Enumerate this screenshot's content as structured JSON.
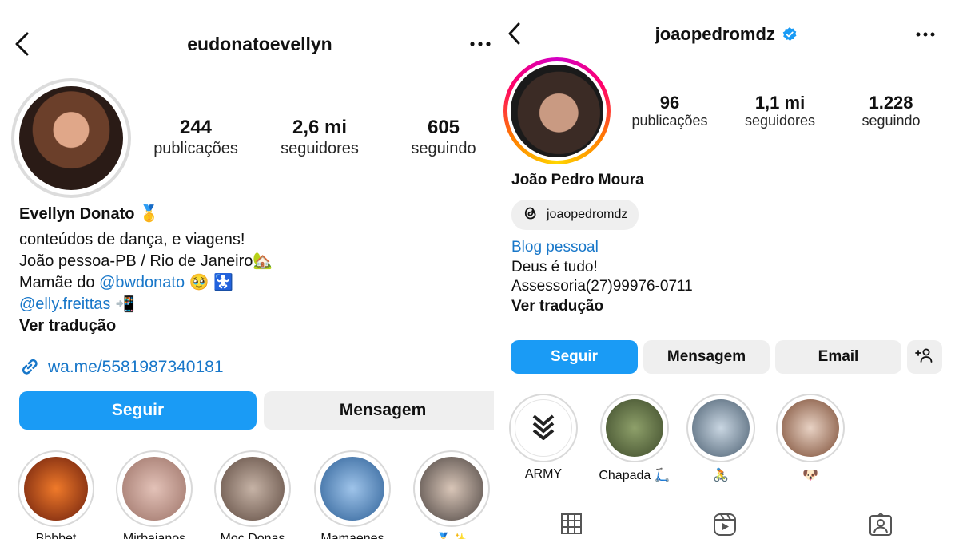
{
  "left": {
    "username": "eudonatoevellyn",
    "stats": [
      {
        "value": "244",
        "label": "publicações"
      },
      {
        "value": "2,6 mi",
        "label": "seguidores"
      },
      {
        "value": "605",
        "label": "seguindo"
      }
    ],
    "name": "Evellyn Donato",
    "name_emoji": "🥇",
    "bio_line1": "conteúdos de dança, e viagens!",
    "bio_line2": "João pessoa-PB / Rio de Janeiro",
    "bio_line2_emoji": "🏡",
    "bio_line3_prefix": "Mamãe do ",
    "bio_line3_mention": "@bwdonato",
    "bio_line3_emoji": "🥹 🚼",
    "bio_line4_mention": "@elly.freittas",
    "bio_line4_emoji": "📲",
    "translate": "Ver tradução",
    "website": "wa.me/5581987340181",
    "follow_button": "Seguir",
    "message_button": "Mensagem",
    "highlights": [
      {
        "label": "Bbbbet",
        "color": "#b8471c"
      },
      {
        "label": "Mirbaianos",
        "color": "#c9a79b"
      },
      {
        "label": "Moc Donas",
        "color": "#8f7b70"
      },
      {
        "label": "Mamaenes",
        "color": "#4f82b8"
      },
      {
        "label": "🏅✨",
        "color": "#7a6c66"
      }
    ]
  },
  "right": {
    "username": "joaopedromdz",
    "verified": true,
    "stats": [
      {
        "value": "96",
        "label": "publicações"
      },
      {
        "value": "1,1 mi",
        "label": "seguidores"
      },
      {
        "value": "1.228",
        "label": "seguindo"
      }
    ],
    "name": "João Pedro Moura",
    "threads_handle": "joaopedromdz",
    "category": "Blog pessoal",
    "bio_line1": "Deus é tudo!",
    "bio_line2": "Assessoria(27)99976-0711",
    "translate": "Ver tradução",
    "follow_button": "Seguir",
    "message_button": "Mensagem",
    "email_button": "Email",
    "highlights": [
      {
        "label": "ARMY",
        "color": "#ffffff"
      },
      {
        "label": "Chapada 🛴",
        "color": "#6a7a4e"
      },
      {
        "label": "🚴",
        "color": "#8aa3b8"
      },
      {
        "label": "🐶",
        "color": "#a06a4a"
      }
    ]
  },
  "colors": {
    "accent": "#1a9bf5",
    "link": "#1877c9",
    "secondary_bg": "#efefef",
    "verified": "#1a9bf5"
  },
  "icons": [
    "back-icon",
    "more-icon",
    "link-icon",
    "verified-icon",
    "threads-icon",
    "add-person-icon",
    "grid-icon",
    "reels-icon",
    "tagged-icon",
    "chevrons-icon"
  ]
}
